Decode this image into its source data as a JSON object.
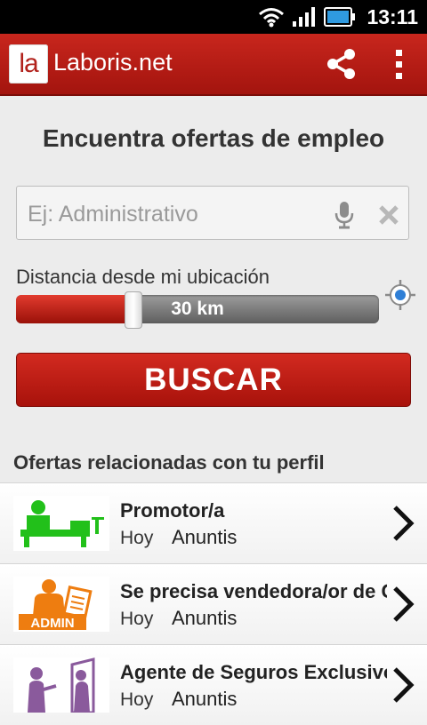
{
  "status_bar": {
    "time": "13:11"
  },
  "action_bar": {
    "logo_text": "la",
    "title": "Laboris.net"
  },
  "main": {
    "heading": "Encuentra ofertas de empleo",
    "search_placeholder": "Ej: Administrativo",
    "distance_label": "Distancia desde mi ubicación",
    "distance_value": "30 km",
    "distance_fraction": 0.3,
    "search_button": "BUSCAR"
  },
  "related": {
    "title": "Ofertas relacionadas con tu perfil",
    "offers": [
      {
        "title": "Promotor/a",
        "date": "Hoy",
        "source": "Anuntis",
        "icon": "promoter-desk-icon"
      },
      {
        "title": "Se precisa vendedora/or de Co",
        "date": "Hoy",
        "source": "Anuntis",
        "icon": "admin-person-icon",
        "icon_label": "ADMIN"
      },
      {
        "title": "Agente de Seguros Exclusivo e",
        "date": "Hoy",
        "source": "Anuntis",
        "icon": "people-door-icon"
      }
    ]
  },
  "colors": {
    "brand_red": "#b2221c",
    "promoter_green": "#22c01a",
    "admin_orange": "#ee7d10",
    "purple": "#8a5a9c"
  }
}
